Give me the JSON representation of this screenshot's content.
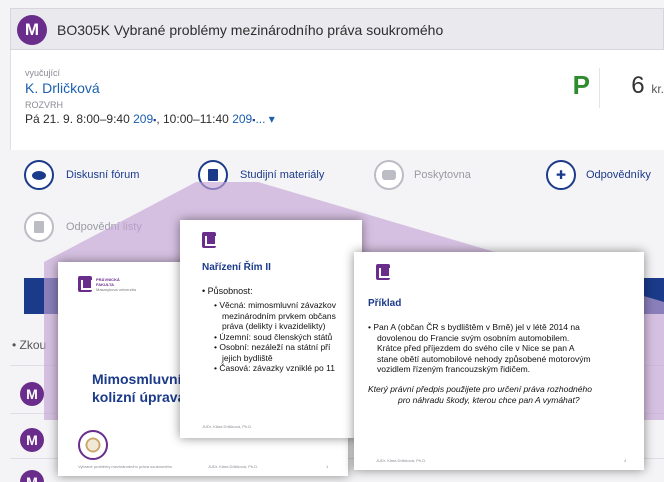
{
  "header": {
    "logo_letter": "M",
    "course_title": "BO305K Vybrané problémy mezinárodního práva soukromého"
  },
  "info": {
    "teacher_label": "vyučující",
    "teacher_name": "K. Drličková",
    "schedule_label": "ROZVRH",
    "schedule_day": "Pá 21. 9. 8:00–9:40",
    "room_1": "209",
    "time_2": ", 10:00–11:40",
    "room_2": "209",
    "more": "... ▾",
    "grade": "P",
    "credits_value": "6",
    "credits_unit": "kr."
  },
  "nav": {
    "items": [
      {
        "label": "Diskusní fórum",
        "icon": "chat-bubble-icon",
        "enabled": true
      },
      {
        "label": "Studijní materiály",
        "icon": "document-icon",
        "enabled": true
      },
      {
        "label": "Poskytovna",
        "icon": "bag-icon",
        "enabled": false
      },
      {
        "label": "Odpovědníky",
        "icon": "star-badge-icon",
        "enabled": true
      },
      {
        "label": "Odpovědní listy",
        "icon": "sheet-icon",
        "enabled": false
      }
    ]
  },
  "list": {
    "partial_text": "• Zkou",
    "logo_letter": "M"
  },
  "slides": {
    "slide1": {
      "faculty_line1": "PRÁVNICKÁ",
      "faculty_line2": "FAKULTA",
      "faculty_line3": "Masarykova univerzita",
      "title_line1": "Mimosmluvní z",
      "title_line2": "kolizní úprava",
      "footer_left": "Vybrané problémy mezinárodního práva soukromého",
      "footer_author": "JUDr. Klára Drličková, Ph.D.",
      "page": "1"
    },
    "slide2": {
      "heading": "Nařízení Řím II",
      "bullet_main": "Působnost:",
      "sub1_line1": "Věcná: mimosmluvní závazkov",
      "sub1_line2": "mezinárodním prvkem občans",
      "sub1_line3": "práva (delikty i kvazidelikty)",
      "sub2": "Územní: soud členských států",
      "sub3_line1": "Osobní: nezáleží na státní pří",
      "sub3_line2": "jejich bydliště",
      "sub4": "Časová: závazky vzniklé po 11",
      "footer_author": "JUDr. Klára Drličková, Ph.D."
    },
    "slide3": {
      "heading": "Příklad",
      "para_line1": "Pan A (občan ČR s bydlištěm v Brně) jel v létě 2014 na",
      "para_line2": "dovolenou do Francie svým osobním automobilem.",
      "para_line3": "Krátce před příjezdem do svého cíle v Nice se pan A",
      "para_line4": "stane obětí automobilové nehody způsobené motorovým",
      "para_line5": "vozidlem řízeným francouzským řidičem.",
      "question_line1": "Který právní předpis použijete pro určení práva rozhodného",
      "question_line2": "pro náhradu škody, kterou chce pan A vymáhat?",
      "footer_author": "JUDr. Klára Drličková, Ph.D.",
      "page": "4"
    }
  },
  "colors": {
    "brand_purple": "#6a2d8c",
    "nav_blue": "#1b3a8a",
    "link_blue": "#1b5fb0",
    "grade_green": "#2e8b2e",
    "callout_lilac": "#c6a4d6"
  }
}
